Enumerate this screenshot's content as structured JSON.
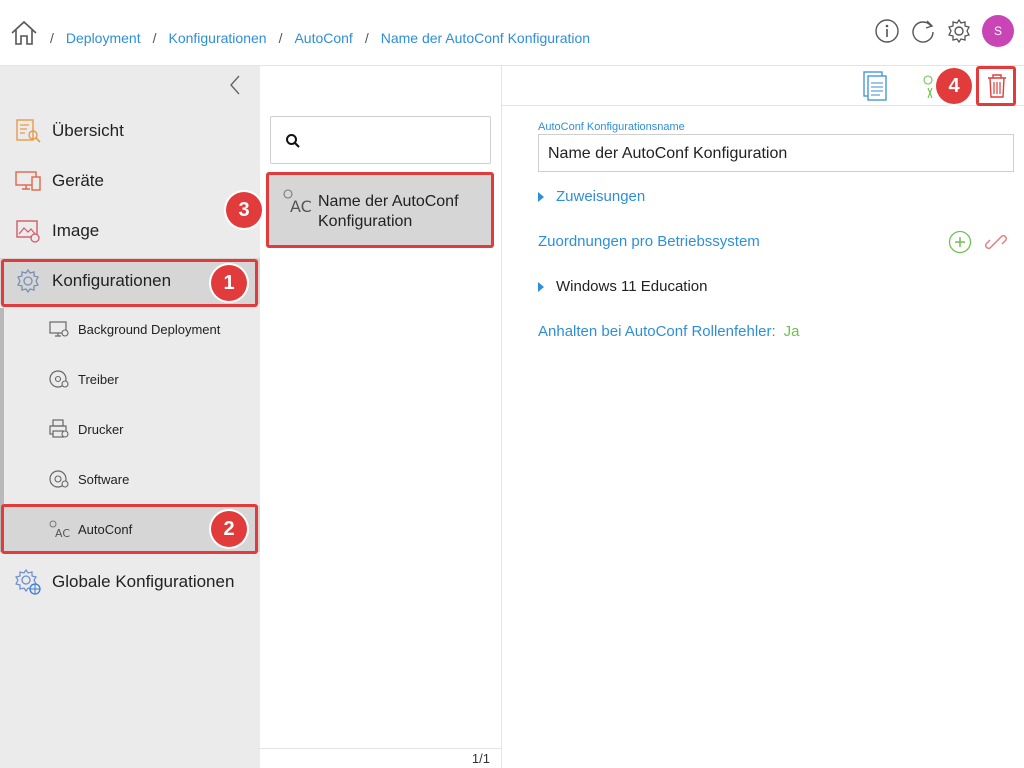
{
  "breadcrumb": [
    "Deployment",
    "Konfigurationen",
    "AutoConf",
    "Name der AutoConf Konfiguration"
  ],
  "breadcrumb_separator": "/",
  "user": {
    "initial": "S",
    "avatar_color": "#c945b5"
  },
  "colors": {
    "accent": "#2e8fd8",
    "highlight": "#e23b3b",
    "green": "#6ec24f",
    "selected_bg": "#d6d6d6"
  },
  "sidebar": {
    "items": [
      {
        "label": "Übersicht",
        "icon": "overview-icon"
      },
      {
        "label": "Geräte",
        "icon": "devices-icon"
      },
      {
        "label": "Image",
        "icon": "image-icon"
      },
      {
        "label": "Konfigurationen",
        "icon": "configurations-gear-icon"
      }
    ],
    "subitems": [
      {
        "label": "Background Deployment",
        "icon": "background-deployment-icon"
      },
      {
        "label": "Treiber",
        "icon": "driver-disc-icon"
      },
      {
        "label": "Drucker",
        "icon": "printer-icon"
      },
      {
        "label": "Software",
        "icon": "software-disc-icon"
      },
      {
        "label": "AutoConf",
        "icon": "autoconf-icon"
      }
    ],
    "global": {
      "label": "Globale Konfigurationen",
      "icon": "global-config-icon"
    }
  },
  "badges": [
    "1",
    "2",
    "3",
    "4"
  ],
  "list": {
    "search_placeholder": "",
    "items": [
      {
        "title": "Name der AutoConf Konfiguration",
        "icon_text": "AC"
      }
    ],
    "pager": "1/1"
  },
  "detail": {
    "name_label": "AutoConf Konfigurationsname",
    "name_value": "Name der AutoConf Konfiguration",
    "assignments": "Zuweisungen",
    "os_mapping": "Zuordnungen pro Betriebssystem",
    "os_item": "Windows 11 Education",
    "stop_on_error_label": "Anhalten bei AutoConf Rollenfehler:",
    "stop_on_error_value": "Ja"
  }
}
